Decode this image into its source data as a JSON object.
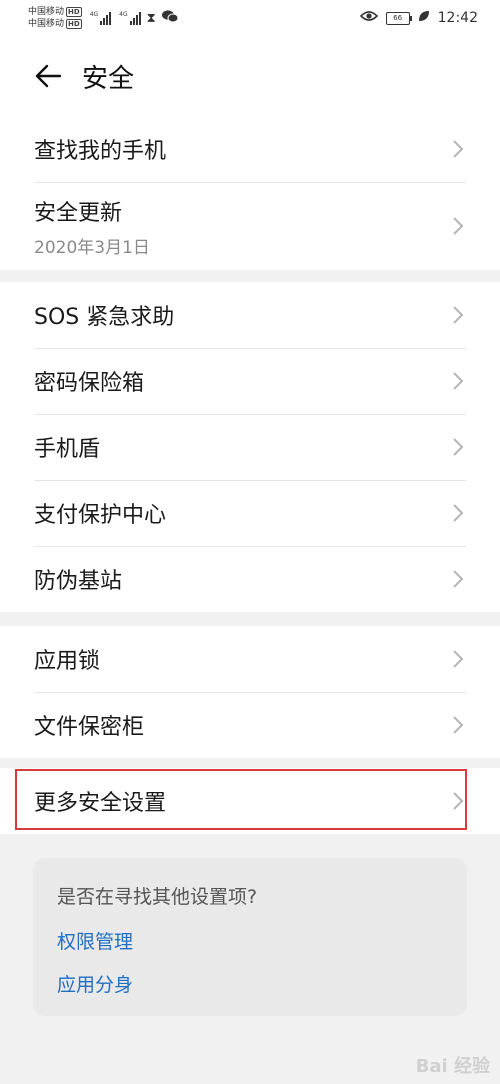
{
  "status_bar": {
    "carrier_1": "中国移动",
    "carrier_2": "中国移动",
    "hd_1": "HD",
    "hd_2": "HD",
    "net_1": "4G",
    "net_2": "4G",
    "battery_level": "66",
    "time": "12:42"
  },
  "header": {
    "title": "安全"
  },
  "group1": {
    "items": [
      {
        "label": "查找我的手机"
      },
      {
        "label": "安全更新",
        "sub": "2020年3月1日"
      }
    ]
  },
  "group2": {
    "items": [
      {
        "label": "SOS 紧急求助"
      },
      {
        "label": "密码保险箱"
      },
      {
        "label": "手机盾"
      },
      {
        "label": "支付保护中心"
      },
      {
        "label": "防伪基站"
      }
    ]
  },
  "group3": {
    "items": [
      {
        "label": "应用锁"
      },
      {
        "label": "文件保密柜"
      }
    ]
  },
  "group4": {
    "items": [
      {
        "label": "更多安全设置"
      }
    ]
  },
  "suggest": {
    "title": "是否在寻找其他设置项?",
    "links": [
      {
        "label": "权限管理"
      },
      {
        "label": "应用分身"
      }
    ]
  },
  "watermark": {
    "text": "Bai 经验"
  },
  "colors": {
    "accent_link": "#1f6fc4",
    "highlight_border": "#d83b3b",
    "background": "#f1f1f1"
  },
  "icons": [
    "back-arrow-icon",
    "chevron-right-icon",
    "eye-icon",
    "leaf-icon",
    "wechat-icon",
    "hourglass-icon"
  ]
}
